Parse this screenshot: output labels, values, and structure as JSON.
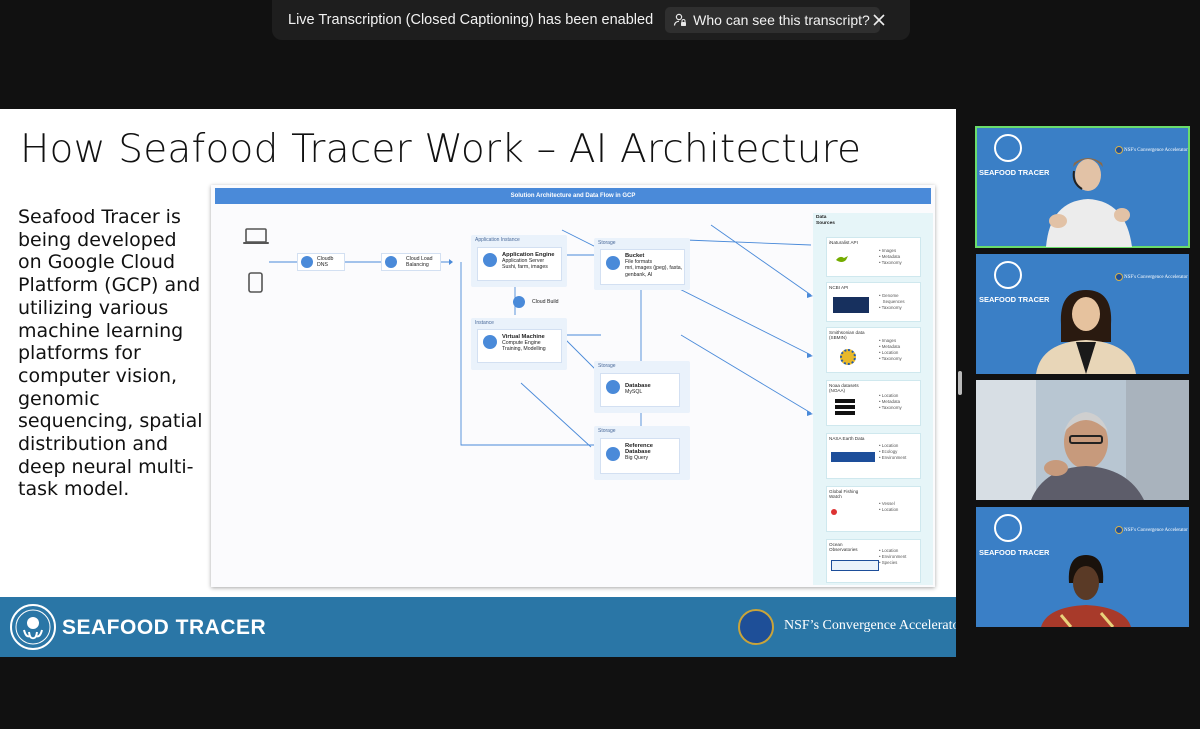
{
  "notification": {
    "message": "Live Transcription (Closed Captioning) has been enabled",
    "who_button": "Who can see this transcript?"
  },
  "slide": {
    "title": "How Seafood Tracer Work – AI Architecture",
    "body": "Seafood Tracer is being developed on Google Cloud Platform (GCP) and utilizing various machine learning platforms for computer vision, genomic sequencing, spatial distribution and deep neural multi-task model.",
    "diagram": {
      "header": "Solution Architecture and Data Flow in GCP",
      "nodes": {
        "cloud_dns": "Cloudb DNS",
        "cloud_lb": "Cloud Load Balancing",
        "app_instance_label": "Application Instance",
        "app_engine_title": "Application Engine",
        "app_engine_sub": "Application Server",
        "app_engine_detail": "Sushi, farm, images",
        "cloud_build": "Cloud Build",
        "instance_label": "Instance",
        "vm_title": "Virtual Machine",
        "vm_sub": "Compute Engine",
        "vm_detail": "Training, Modelling",
        "storage_label": "Storage",
        "bucket_title": "Bucket",
        "bucket_sub": "File formats",
        "bucket_detail": "mri, images (jpeg), fasta, genbank, AI",
        "database_title": "Database",
        "database_sub": "MySQL",
        "refdb_title": "Reference Database",
        "refdb_sub": "Big Query"
      },
      "sources_title": "Data Sources",
      "sources": [
        {
          "label": "iNaturalist API",
          "items": "• Images\n• Metadata\n• Taxonomy"
        },
        {
          "label": "NCBI API",
          "items": "• Genome\n   Sequences\n• Taxonomy"
        },
        {
          "label": "Smithsonian data (SBMIN)",
          "items": "• Images\n• Metadata\n• Location\n• Taxonomy"
        },
        {
          "label": "Noaa datasets (NOAA)",
          "items": "• Location\n• Metadata\n• Taxonomy"
        },
        {
          "label": "NASA Earth Data",
          "items": "• Location\n• Ecology\n• Environment"
        },
        {
          "label": "Global Fishing Watch",
          "items": "• Vessel\n• Location"
        },
        {
          "label": "Ocean Observatories",
          "items": "• Location\n• Environment\n• Species"
        }
      ]
    },
    "footer": {
      "brand": "SEAFOOD TRACER",
      "partner": "NSF’s Convergence Accelerator"
    }
  },
  "participants": [
    {
      "brand": "SEAFOOD TRACER",
      "partner": "NSF's Convergence Accelerator",
      "speaking": true
    },
    {
      "brand": "SEAFOOD TRACER",
      "partner": "NSF's Convergence Accelerator",
      "speaking": false
    },
    {
      "brand": "",
      "partner": "",
      "speaking": false
    },
    {
      "brand": "SEAFOOD TRACER",
      "partner": "NSF's Convergence Accelerator",
      "speaking": false
    }
  ],
  "colors": {
    "slide_footer": "#2a76a6",
    "tile_background": "#3a7fc6",
    "active_speaker_border": "#6bdc6b",
    "diagram_header": "#4a8ad9"
  }
}
